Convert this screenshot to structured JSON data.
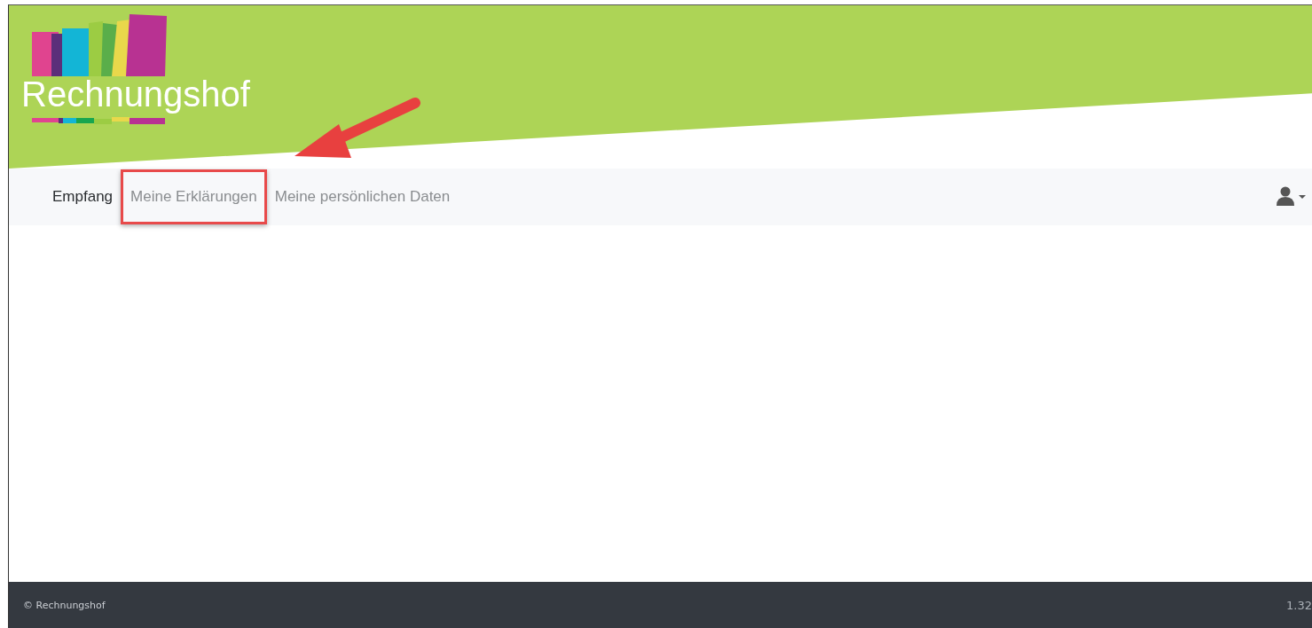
{
  "brand": {
    "name": "Rechnungshof"
  },
  "nav": [
    {
      "label": "Empfang",
      "selected": true,
      "highlighted": false
    },
    {
      "label": "Meine Erklärungen",
      "selected": false,
      "highlighted": true
    },
    {
      "label": "Meine persönlichen Daten",
      "selected": false,
      "highlighted": false
    }
  ],
  "footer": {
    "copyright": "© Rechnungshof",
    "version": "1.32"
  }
}
